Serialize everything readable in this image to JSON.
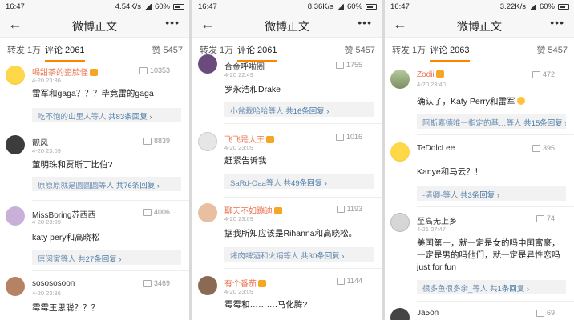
{
  "status_bars": [
    {
      "time": "16:47",
      "net": "4.54K/s",
      "battery": "60%"
    },
    {
      "time": "16:47",
      "net": "8.36K/s",
      "battery": "60%"
    },
    {
      "time": "16:47",
      "net": "3.22K/s",
      "battery": "60%"
    }
  ],
  "nav": {
    "title": "微博正文",
    "back_icon": "←",
    "more_icon": "•••"
  },
  "panels": [
    {
      "tabs": {
        "repost": "转发 1万",
        "comment": "评论 2061",
        "like": "赞 5457"
      },
      "comments": [
        {
          "user": "喝甜茶的歪脸怪",
          "time": "4-20 23:36",
          "likes": "10353",
          "text": "雷军和gaga？？？毕竟雷的gaga",
          "reply_users": "吃不饱的山里人等人",
          "reply_count": "共83条回复"
        },
        {
          "user": "靓风",
          "time": "4-20 23:09",
          "likes": "8839",
          "text": "董明珠和贾斯丁比伯?",
          "reply_users": "原原原就是圆圆圆等人",
          "reply_count": "共76条回复"
        },
        {
          "user": "MissBoring苏西西",
          "time": "4-20 23:09",
          "likes": "4006",
          "text": "katy pery和高晓松",
          "reply_users": "唐闵寅等人",
          "reply_count": "共27条回复"
        },
        {
          "user": "sosososoon",
          "time": "4-20 23:36",
          "likes": "3469",
          "text": "霉霉王思聪？？？",
          "reply_users": "",
          "reply_count": ""
        }
      ]
    },
    {
      "tabs": {
        "repost": "转发 1万",
        "comment": "评论 2061",
        "like": "赞 5457"
      },
      "comments": [
        {
          "user": "合金呼啦圈",
          "time": "4-20 22:49",
          "likes": "1755",
          "text": "罗永浩和Drake",
          "reply_users": "小盆栽哈哈等人",
          "reply_count": "共16条回复"
        },
        {
          "user": "飞飞是大王",
          "time": "4-20 23:09",
          "likes": "1016",
          "text": "赶紧告诉我",
          "reply_users": "SaRd-Oaa等人",
          "reply_count": "共49条回复"
        },
        {
          "user": "聊天不如蹦迪",
          "time": "4-20 23:09",
          "likes": "1193",
          "text": "据我所知应该是Rihanna和高晓松。",
          "reply_users": "烤肉啤酒和火锅等人",
          "reply_count": "共30条回复"
        },
        {
          "user": "有个番茄",
          "time": "4-20 23:09",
          "likes": "1144",
          "text": "霉霉和……….马化腾?",
          "reply_users": "",
          "reply_count": ""
        }
      ]
    },
    {
      "tabs": {
        "repost": "转发 1万",
        "comment": "评论 2063",
        "like": "赞 5457"
      },
      "comments": [
        {
          "user": "Zodii",
          "time": "4-20 23:40",
          "likes": "472",
          "text": "确认了，Katy Perry和雷军",
          "reply_users": "阿斯嘉德唯一指定的基…等人",
          "reply_count": "共15条回复"
        },
        {
          "user": "TeDolcLee",
          "time": "4-20 23:09",
          "likes": "395",
          "text": "Kanye和马云？！",
          "reply_users": "-清卿-等人",
          "reply_count": "共3条回复"
        },
        {
          "user": "至高无上乡",
          "time": "4-21 07:47",
          "likes": "74",
          "text": "美国第一，就一定是女的吗中国富豪，一定是男的吗他们，就一定是异性恋吗just for fun",
          "reply_users": "很多鱼很多余_等人",
          "reply_count": "共1条回复"
        },
        {
          "user": "Ja5on",
          "time": "",
          "likes": "69",
          "text": "",
          "reply_users": "",
          "reply_count": ""
        }
      ]
    }
  ]
}
